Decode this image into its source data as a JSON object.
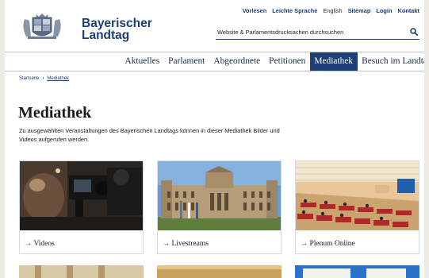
{
  "header": {
    "brand_line1": "Bayerischer",
    "brand_line2": "Landtag",
    "top_links": [
      "Vorlesen",
      "Leichte Sprache",
      "English",
      "Sitemap",
      "Login",
      "Kontakt"
    ],
    "search_placeholder": "Website & Parlamentsdrucksachen durchsuchen"
  },
  "nav": {
    "items": [
      "Aktuelles",
      "Parlament",
      "Abgeordnete",
      "Petitionen",
      "Mediathek",
      "Besuch im Landtag"
    ],
    "active": "Mediathek"
  },
  "breadcrumb": {
    "home": "Startseite",
    "sep": "›",
    "current": "Mediathek"
  },
  "main": {
    "title": "Mediathek",
    "intro": "Zu ausgewählten Veranstaltungen des Bayerischen Landtags können in dieser Mediathek Bilder und Videos aufgerufen werden."
  },
  "cards": [
    {
      "label": "Videos",
      "arrow": "→"
    },
    {
      "label": "Livestreams",
      "arrow": "→"
    },
    {
      "label": "Plenum Online",
      "arrow": "→"
    }
  ],
  "colors": {
    "brand": "#1d3f73",
    "page_bg": "#eceae3"
  }
}
